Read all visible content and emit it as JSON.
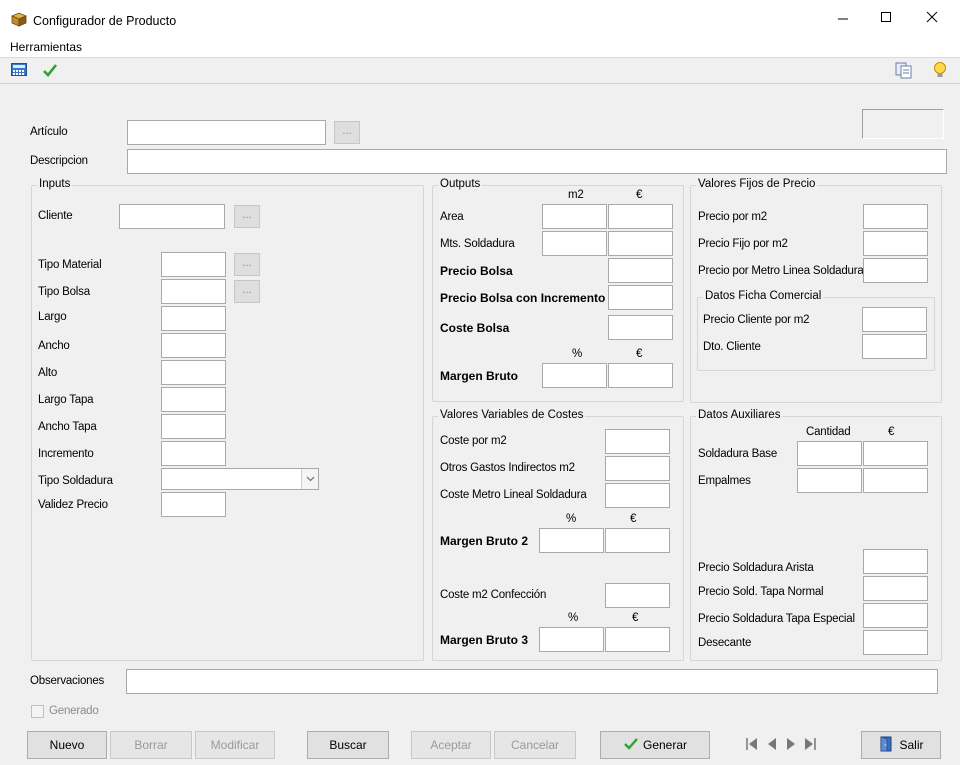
{
  "window": {
    "title": "Configurador de Producto"
  },
  "menu": {
    "tools": "Herramientas"
  },
  "top": {
    "articulo_label": "Artículo",
    "articulo_dots": "...",
    "descripcion_label": "Descripcion"
  },
  "inputs": {
    "title": "Inputs",
    "cliente": "Cliente",
    "dots": "...",
    "tipo_material": "Tipo Material",
    "tipo_bolsa": "Tipo Bolsa",
    "largo": "Largo",
    "ancho": "Ancho",
    "alto": "Alto",
    "largo_tapa": "Largo Tapa",
    "ancho_tapa": "Ancho Tapa",
    "incremento": "Incremento",
    "tipo_soldadura": "Tipo Soldadura",
    "validez_precio": "Validez Precio"
  },
  "outputs": {
    "title": "Outputs",
    "col_m2": "m2",
    "col_eur": "€",
    "area": "Area",
    "mts_soldadura": "Mts. Soldadura",
    "precio_bolsa": "Precio Bolsa",
    "precio_bolsa_inc": "Precio Bolsa con Incremento",
    "coste_bolsa": "Coste Bolsa",
    "col_pct": "%",
    "margen_bruto": "Margen Bruto"
  },
  "fijos": {
    "title": "Valores Fijos de Precio",
    "precio_m2": "Precio por m2",
    "precio_fijo_m2": "Precio Fijo por m2",
    "precio_metro_linea": "Precio por Metro Linea Soldadura",
    "ficha_title": "Datos Ficha Comercial",
    "precio_cliente_m2": "Precio Cliente por m2",
    "dto_cliente": "Dto. Cliente"
  },
  "variables": {
    "title": "Valores Variables de Costes",
    "coste_m2": "Coste por m2",
    "otros_gastos": "Otros Gastos Indirectos m2",
    "coste_metro_lineal": "Coste Metro Lineal Soldadura",
    "col_pct": "%",
    "col_eur": "€",
    "margen_bruto_2": "Margen Bruto 2",
    "coste_m2_confeccion": "Coste m2 Confección",
    "margen_bruto_3": "Margen Bruto 3"
  },
  "auxiliares": {
    "title": "Datos Auxiliares",
    "col_cantidad": "Cantidad",
    "col_eur": "€",
    "soldadura_base": "Soldadura Base",
    "empalmes": "Empalmes",
    "precio_sold_arista": "Precio Soldadura Arista",
    "precio_sold_tapa_normal": "Precio Sold. Tapa Normal",
    "precio_sold_tapa_especial": "Precio Soldadura Tapa Especial",
    "desecante": "Desecante"
  },
  "bottom": {
    "observaciones": "Observaciones",
    "generado": "Generado"
  },
  "buttons": {
    "nuevo": "Nuevo",
    "borrar": "Borrar",
    "modificar": "Modificar",
    "buscar": "Buscar",
    "aceptar": "Aceptar",
    "cancelar": "Cancelar",
    "generar": "Generar",
    "salir": "Salir"
  },
  "colors": {
    "accent_check": "#2ea12e",
    "title_icon": "#b8862b"
  }
}
